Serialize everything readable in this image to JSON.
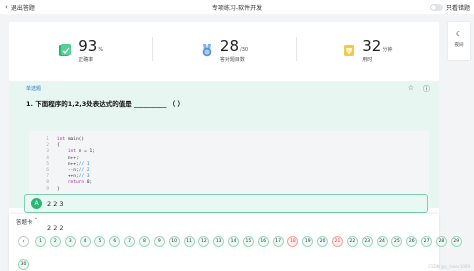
{
  "topbar": {
    "back_label": "退出答题",
    "title": "专项练习-软件开发",
    "toggle_label": "只看错题"
  },
  "stats": [
    {
      "value": "93",
      "unit": "%",
      "label": "正确率",
      "icon": "chart-badge-icon"
    },
    {
      "value": "28",
      "unit": "/30",
      "label": "答对题目数",
      "icon": "medal-icon"
    },
    {
      "value": "32",
      "unit": "分钟",
      "label": "用时",
      "icon": "trophy-icon"
    }
  ],
  "question": {
    "type": "单选题",
    "title": "1. 下面程序的1,2,3处表达式的值是 __________ （ ）",
    "code": [
      {
        "n": "1",
        "text": "int main()"
      },
      {
        "n": "2",
        "text": "{"
      },
      {
        "n": "3",
        "text": "    int n = 1;"
      },
      {
        "n": "4",
        "text": "    n++;"
      },
      {
        "n": "5",
        "text": "    n++;",
        "comment": "// 1"
      },
      {
        "n": "6",
        "text": "    --n;",
        "comment": "// 2"
      },
      {
        "n": "7",
        "text": "    ++n;",
        "comment": "// 3"
      },
      {
        "n": "8",
        "text": "    return 0;"
      },
      {
        "n": "9",
        "text": "}"
      }
    ]
  },
  "answer": {
    "letter": "A",
    "text": "2 2 3"
  },
  "sheet": {
    "title": "答题卡",
    "toggle_icon": "˅",
    "peek_text": "2 2 2",
    "prev": "‹",
    "numbers": [
      "1",
      "2",
      "3",
      "4",
      "5",
      "6",
      "7",
      "8",
      "9",
      "10",
      "11",
      "12",
      "13",
      "14",
      "15",
      "16",
      "17",
      "18",
      "19",
      "20",
      "21",
      "22",
      "23",
      "24",
      "25",
      "26",
      "27",
      "28",
      "29"
    ],
    "wrong": [
      "18",
      "21"
    ],
    "last_row": [
      "30"
    ]
  },
  "side": {
    "label": "夜间",
    "icon": "moon-icon"
  },
  "watermark": "CSDN @y_lovec1009",
  "colors": {
    "accent": "#2bb673",
    "panel": "#e8f6f1",
    "wrong": "#d34a4a"
  }
}
